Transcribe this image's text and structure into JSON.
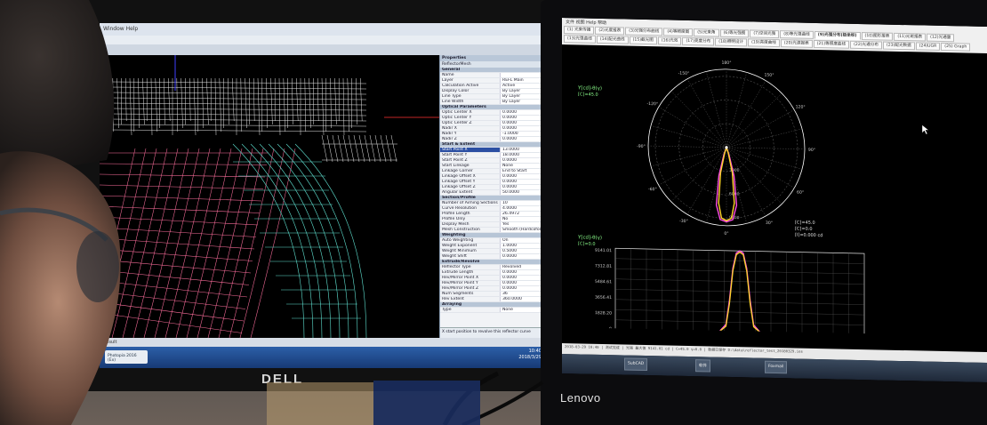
{
  "left_monitor": {
    "brand": "DELL",
    "menu": "Window  Help",
    "properties": {
      "title": "Properties",
      "subtitle": "ReflectorMesh",
      "rows": [
        {
          "section": "General"
        },
        {
          "name": "Name",
          "value": ""
        },
        {
          "name": "Layer",
          "value": "REFL Main"
        },
        {
          "name": "Calculation Active",
          "value": "Active"
        },
        {
          "name": "Display Color",
          "value": "By Layer"
        },
        {
          "name": "Line Type",
          "value": "By Layer"
        },
        {
          "name": "Line Width",
          "value": "By Layer"
        },
        {
          "section": "Optical Parameters"
        },
        {
          "name": "Optic Center X",
          "value": "0.0000"
        },
        {
          "name": "Optic Center Y",
          "value": "0.0000"
        },
        {
          "name": "Optic Center Z",
          "value": "0.0000"
        },
        {
          "name": "Nadir X",
          "value": "0.0000"
        },
        {
          "name": "Nadir Y",
          "value": "-1.0000"
        },
        {
          "name": "Nadir Z",
          "value": "0.0000"
        },
        {
          "section": "Start & Extent"
        },
        {
          "name": "Start Point X",
          "value": "13.0000",
          "selected": true
        },
        {
          "name": "Start Point Y",
          "value": "18.0000"
        },
        {
          "name": "Start Point Z",
          "value": "0.0000"
        },
        {
          "name": "Start Linkage",
          "value": "None"
        },
        {
          "name": "Linkage Corner",
          "value": "End to Start"
        },
        {
          "name": "Linkage Offset X",
          "value": "0.0000"
        },
        {
          "name": "Linkage Offset Y",
          "value": "0.0000"
        },
        {
          "name": "Linkage Offset Z",
          "value": "0.0000"
        },
        {
          "name": "Angular Extent",
          "value": "50.0000"
        },
        {
          "section": "Section/Profile"
        },
        {
          "name": "Number of Aiming Sections",
          "value": "10"
        },
        {
          "name": "Curve Resolution",
          "value": "4.0000"
        },
        {
          "name": "Profile Length",
          "value": "26.4972"
        },
        {
          "name": "Profile Only",
          "value": "No"
        },
        {
          "name": "Display Mesh",
          "value": "Yes"
        },
        {
          "name": "Mesh Construction",
          "value": "Smooth (Hardcoformed)"
        },
        {
          "section": "Weighting"
        },
        {
          "name": "Auto Weighting",
          "value": "On"
        },
        {
          "name": "Weight Exponent",
          "value": "1.0000"
        },
        {
          "name": "Weight Minimum",
          "value": "0.5000"
        },
        {
          "name": "Weight Shift",
          "value": "0.0000"
        },
        {
          "section": "Extrude/Revolve"
        },
        {
          "name": "Reflector Type",
          "value": "Revolved"
        },
        {
          "name": "Extrude Length",
          "value": "0.0000"
        },
        {
          "name": "Rev/Mirror Point X",
          "value": "0.0000"
        },
        {
          "name": "Rev/Mirror Point Y",
          "value": "0.0000"
        },
        {
          "name": "Rev/Mirror Point Z",
          "value": "0.0000"
        },
        {
          "name": "Num Segments",
          "value": "36"
        },
        {
          "name": "Rev Extent",
          "value": "360.0000"
        },
        {
          "section": "Arraying"
        },
        {
          "name": "Type",
          "value": "None"
        }
      ],
      "footer": "X start position to revolve this reflector curve"
    },
    "status": "Result",
    "taskbar": {
      "tab": "Photopia 2016 (Ex)",
      "time": "10:40",
      "date": "2018/3/29"
    }
  },
  "right_monitor": {
    "brand": "Lenovo",
    "menu": "文件  视图  Help  帮助",
    "tabs": [
      "(1) 光束传播",
      "(2)光度报表",
      "(3)光强分布曲线",
      "(4)等照度图",
      "(5)光束角",
      "(6)等光强图",
      "(7)空间光强",
      "(8)等光强曲线",
      "(9)光强分布(极坐标)",
      "(10)图形报表",
      "(11)光斑报表",
      "(12)光通量",
      "(13)光强曲线",
      "(14)配光曲线",
      "(15)截光图",
      "(16)光效",
      "(17)亮度分布",
      "(18)照明设计",
      "(19)亮度曲线",
      "(20)光源报表",
      "(21)等照度曲线",
      "(22)光通分布",
      "(23)配光数据",
      "(24)UGR",
      "(25) Graph"
    ],
    "polar": {
      "ylabel": "Y[cd]-θ(γ)",
      "clabel": "[C]=45.0",
      "angles": [
        "0°",
        "30°",
        "60°",
        "90°",
        "120°",
        "150°",
        "180°",
        "-30°",
        "-60°",
        "-90°",
        "-120°",
        "-150°"
      ],
      "rings": [
        "3000",
        "6000",
        "9000"
      ]
    },
    "linear": {
      "ylabel": "Y[cd]-θ(γ)",
      "clabel": "[C]=0.0",
      "legend": [
        "[C]=45.0",
        "[C]=0.0",
        "[I]=0.000 cd"
      ],
      "yticks": [
        "9141.01",
        "7312.81",
        "5484.61",
        "3656.41",
        "1828.20",
        "0"
      ],
      "xticks": [
        "-180°",
        "-135°",
        "-90°",
        "-45°",
        "0°",
        "45°",
        "90°",
        "135°",
        "180°"
      ]
    },
    "status_line": "2018-03-29 10:40 | 测试完成 | 光强 最大值 9141.01 cd | C=45.0 γ=0.0 | 数据已保存 D:\\data\\reflector_test_20180329.ies",
    "taskbar": [
      "SubCAD",
      "软件",
      "Foxmail"
    ]
  },
  "chart_data": [
    {
      "type": "polar",
      "title": "",
      "series": [
        {
          "name": "[C]=45.0",
          "color": "#ff4de6",
          "angles_deg": [
            -20,
            -15,
            -10,
            -5,
            0,
            5,
            10,
            15,
            20
          ],
          "values": [
            900,
            3600,
            7200,
            8900,
            9141,
            8900,
            7200,
            3600,
            900
          ]
        },
        {
          "name": "[C]=0.0",
          "color": "#ffd42a",
          "angles_deg": [
            -18,
            -13,
            -8,
            -4,
            0,
            4,
            8,
            13,
            18
          ],
          "values": [
            700,
            3200,
            6900,
            8700,
            9000,
            8700,
            6900,
            3200,
            700
          ]
        }
      ]
    },
    {
      "type": "line",
      "title": "",
      "xlabel": "",
      "ylabel": "",
      "xlim": [
        -180,
        180
      ],
      "ylim": [
        0,
        9141.01
      ],
      "x": [
        -180,
        -60,
        -30,
        -20,
        -15,
        -10,
        -5,
        0,
        5,
        10,
        15,
        20,
        30,
        60,
        180
      ],
      "series": [
        {
          "name": "[C]=45.0",
          "color": "#ff4de6",
          "values": [
            0,
            0,
            60,
            900,
            3600,
            7200,
            8900,
            9141,
            8900,
            7200,
            3600,
            900,
            60,
            0,
            0
          ]
        },
        {
          "name": "[C]=0.0",
          "color": "#ffd42a",
          "values": [
            0,
            0,
            40,
            700,
            3200,
            6900,
            8700,
            9000,
            8700,
            6900,
            3200,
            700,
            40,
            0,
            0
          ]
        }
      ]
    }
  ]
}
